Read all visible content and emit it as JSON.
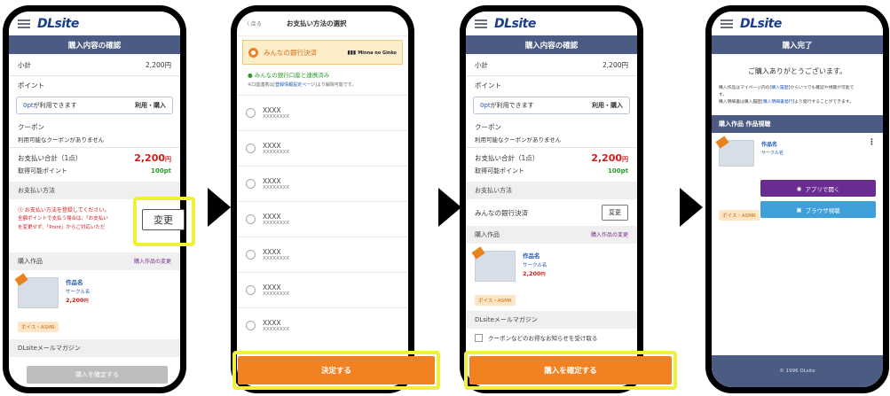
{
  "logo": "DLsite",
  "s1": {
    "title": "購入内容の確認",
    "subtotal_label": "小計",
    "subtotal_value": "2,200円",
    "point_label": "ポイント",
    "point_avail_amount": "0pt",
    "point_avail_text": "が利用できます",
    "point_use": "利用・購入",
    "coupon_label": "クーポン",
    "coupon_note": "利用可能なクーポンがありません",
    "total_label": "お支払い合計（1点）",
    "total_value": "2,200",
    "total_unit": "円",
    "earn_label": "取得可能ポイント",
    "earn_value": "100pt",
    "pay_section": "お支払い方法",
    "pay_warn1": "⓵ お支払い方法を登録してください。",
    "pay_warn2": "全額ポイントで支払う場合は、「お支払い",
    "pay_warn3": "を変更せず、「Point」からご対応いただ",
    "change_btn": "変更",
    "items_label": "購入作品",
    "items_change": "購入作品の変更",
    "work_name": "作品名",
    "circle_name": "サークル名",
    "work_price": "2,200",
    "work_unit": "円",
    "work_tag": "ボイス・ASMR",
    "mag_label": "DLsiteメールマガジン",
    "confirm_btn": "購入を確定する"
  },
  "s2": {
    "back": "〈 戻る",
    "title": "お支払い方法の選択",
    "selected_label": "みんなの銀行決済",
    "bank_logo": "Minna no Ginko",
    "linked_status": "みんなの銀行口座と連携済み",
    "linked_note_pre": "※口座連携は[",
    "linked_note_link": "登録情報設定ページ",
    "linked_note_post": "]より解除可能です。",
    "options": [
      {
        "t1": "XXXX",
        "t2": "XXXXXXXX"
      },
      {
        "t1": "XXXX",
        "t2": "XXXXXXXX"
      },
      {
        "t1": "XXXX",
        "t2": "XXXXXXXX"
      },
      {
        "t1": "XXXX",
        "t2": "XXXXXXXX"
      },
      {
        "t1": "XXXX",
        "t2": "XXXXXXXX"
      },
      {
        "t1": "XXXX",
        "t2": "XXXXXXXX"
      },
      {
        "t1": "XXXX",
        "t2": "XXXXXXXX"
      }
    ],
    "decide_btn": "決定する"
  },
  "s3": {
    "title": "購入内容の確認",
    "subtotal_label": "小計",
    "subtotal_value": "2,200円",
    "point_label": "ポイント",
    "point_avail_amount": "0pt",
    "point_avail_text": "が利用できます",
    "point_use": "利用・購入",
    "coupon_label": "クーポン",
    "coupon_note": "利用可能なクーポンがありません",
    "total_label": "お支払い合計（1点）",
    "total_value": "2,200",
    "total_unit": "円",
    "earn_label": "取得可能ポイント",
    "earn_value": "100pt",
    "pay_section": "お支払い方法",
    "pay_method": "みんなの銀行決済",
    "change_btn": "変更",
    "items_label": "購入作品",
    "items_change": "購入作品の変更",
    "work_name": "作品名",
    "circle_name": "サークル名",
    "work_price": "2,200",
    "work_unit": "円",
    "work_tag": "ボイス・ASMR",
    "mag_label": "DLsiteメールマガジン",
    "mag_check": "クーポンなどのお得なお知らせを受け取る",
    "confirm_btn": "購入を確定する"
  },
  "s4": {
    "title": "購入完了",
    "thanks": "ご購入ありがとうございます。",
    "note1_pre": "購入作品はマイページ内の[",
    "note1_link": "購入履歴",
    "note1_post": "]からいつでも確認や視聴が可能で",
    "note2": "す。",
    "note3_pre": "購入明細書は購入履歴[",
    "note3_link": "購入明細書発行",
    "note3_post": "]より発行することができます。",
    "section": "購入作品 作品視聴",
    "work_name": "作品名",
    "circle_name": "サークル名",
    "work_tag": "ボイス・ASMR",
    "app_btn": "アプリで開く",
    "browser_btn": "ブラウザ視聴",
    "footer": "© 1996 DLsite"
  }
}
